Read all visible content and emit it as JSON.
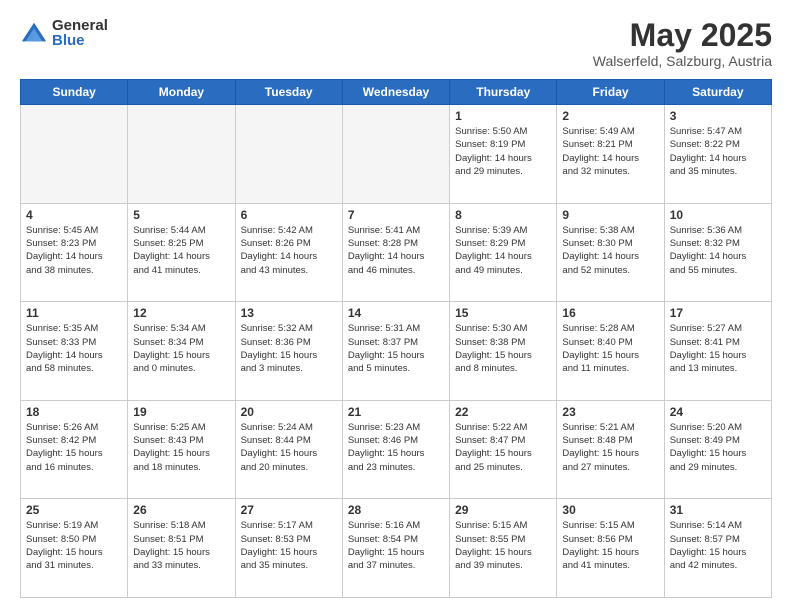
{
  "logo": {
    "general": "General",
    "blue": "Blue"
  },
  "header": {
    "month": "May 2025",
    "location": "Walserfeld, Salzburg, Austria"
  },
  "weekdays": [
    "Sunday",
    "Monday",
    "Tuesday",
    "Wednesday",
    "Thursday",
    "Friday",
    "Saturday"
  ],
  "weeks": [
    [
      {
        "day": "",
        "info": ""
      },
      {
        "day": "",
        "info": ""
      },
      {
        "day": "",
        "info": ""
      },
      {
        "day": "",
        "info": ""
      },
      {
        "day": "1",
        "info": "Sunrise: 5:50 AM\nSunset: 8:19 PM\nDaylight: 14 hours\nand 29 minutes."
      },
      {
        "day": "2",
        "info": "Sunrise: 5:49 AM\nSunset: 8:21 PM\nDaylight: 14 hours\nand 32 minutes."
      },
      {
        "day": "3",
        "info": "Sunrise: 5:47 AM\nSunset: 8:22 PM\nDaylight: 14 hours\nand 35 minutes."
      }
    ],
    [
      {
        "day": "4",
        "info": "Sunrise: 5:45 AM\nSunset: 8:23 PM\nDaylight: 14 hours\nand 38 minutes."
      },
      {
        "day": "5",
        "info": "Sunrise: 5:44 AM\nSunset: 8:25 PM\nDaylight: 14 hours\nand 41 minutes."
      },
      {
        "day": "6",
        "info": "Sunrise: 5:42 AM\nSunset: 8:26 PM\nDaylight: 14 hours\nand 43 minutes."
      },
      {
        "day": "7",
        "info": "Sunrise: 5:41 AM\nSunset: 8:28 PM\nDaylight: 14 hours\nand 46 minutes."
      },
      {
        "day": "8",
        "info": "Sunrise: 5:39 AM\nSunset: 8:29 PM\nDaylight: 14 hours\nand 49 minutes."
      },
      {
        "day": "9",
        "info": "Sunrise: 5:38 AM\nSunset: 8:30 PM\nDaylight: 14 hours\nand 52 minutes."
      },
      {
        "day": "10",
        "info": "Sunrise: 5:36 AM\nSunset: 8:32 PM\nDaylight: 14 hours\nand 55 minutes."
      }
    ],
    [
      {
        "day": "11",
        "info": "Sunrise: 5:35 AM\nSunset: 8:33 PM\nDaylight: 14 hours\nand 58 minutes."
      },
      {
        "day": "12",
        "info": "Sunrise: 5:34 AM\nSunset: 8:34 PM\nDaylight: 15 hours\nand 0 minutes."
      },
      {
        "day": "13",
        "info": "Sunrise: 5:32 AM\nSunset: 8:36 PM\nDaylight: 15 hours\nand 3 minutes."
      },
      {
        "day": "14",
        "info": "Sunrise: 5:31 AM\nSunset: 8:37 PM\nDaylight: 15 hours\nand 5 minutes."
      },
      {
        "day": "15",
        "info": "Sunrise: 5:30 AM\nSunset: 8:38 PM\nDaylight: 15 hours\nand 8 minutes."
      },
      {
        "day": "16",
        "info": "Sunrise: 5:28 AM\nSunset: 8:40 PM\nDaylight: 15 hours\nand 11 minutes."
      },
      {
        "day": "17",
        "info": "Sunrise: 5:27 AM\nSunset: 8:41 PM\nDaylight: 15 hours\nand 13 minutes."
      }
    ],
    [
      {
        "day": "18",
        "info": "Sunrise: 5:26 AM\nSunset: 8:42 PM\nDaylight: 15 hours\nand 16 minutes."
      },
      {
        "day": "19",
        "info": "Sunrise: 5:25 AM\nSunset: 8:43 PM\nDaylight: 15 hours\nand 18 minutes."
      },
      {
        "day": "20",
        "info": "Sunrise: 5:24 AM\nSunset: 8:44 PM\nDaylight: 15 hours\nand 20 minutes."
      },
      {
        "day": "21",
        "info": "Sunrise: 5:23 AM\nSunset: 8:46 PM\nDaylight: 15 hours\nand 23 minutes."
      },
      {
        "day": "22",
        "info": "Sunrise: 5:22 AM\nSunset: 8:47 PM\nDaylight: 15 hours\nand 25 minutes."
      },
      {
        "day": "23",
        "info": "Sunrise: 5:21 AM\nSunset: 8:48 PM\nDaylight: 15 hours\nand 27 minutes."
      },
      {
        "day": "24",
        "info": "Sunrise: 5:20 AM\nSunset: 8:49 PM\nDaylight: 15 hours\nand 29 minutes."
      }
    ],
    [
      {
        "day": "25",
        "info": "Sunrise: 5:19 AM\nSunset: 8:50 PM\nDaylight: 15 hours\nand 31 minutes."
      },
      {
        "day": "26",
        "info": "Sunrise: 5:18 AM\nSunset: 8:51 PM\nDaylight: 15 hours\nand 33 minutes."
      },
      {
        "day": "27",
        "info": "Sunrise: 5:17 AM\nSunset: 8:53 PM\nDaylight: 15 hours\nand 35 minutes."
      },
      {
        "day": "28",
        "info": "Sunrise: 5:16 AM\nSunset: 8:54 PM\nDaylight: 15 hours\nand 37 minutes."
      },
      {
        "day": "29",
        "info": "Sunrise: 5:15 AM\nSunset: 8:55 PM\nDaylight: 15 hours\nand 39 minutes."
      },
      {
        "day": "30",
        "info": "Sunrise: 5:15 AM\nSunset: 8:56 PM\nDaylight: 15 hours\nand 41 minutes."
      },
      {
        "day": "31",
        "info": "Sunrise: 5:14 AM\nSunset: 8:57 PM\nDaylight: 15 hours\nand 42 minutes."
      }
    ]
  ]
}
